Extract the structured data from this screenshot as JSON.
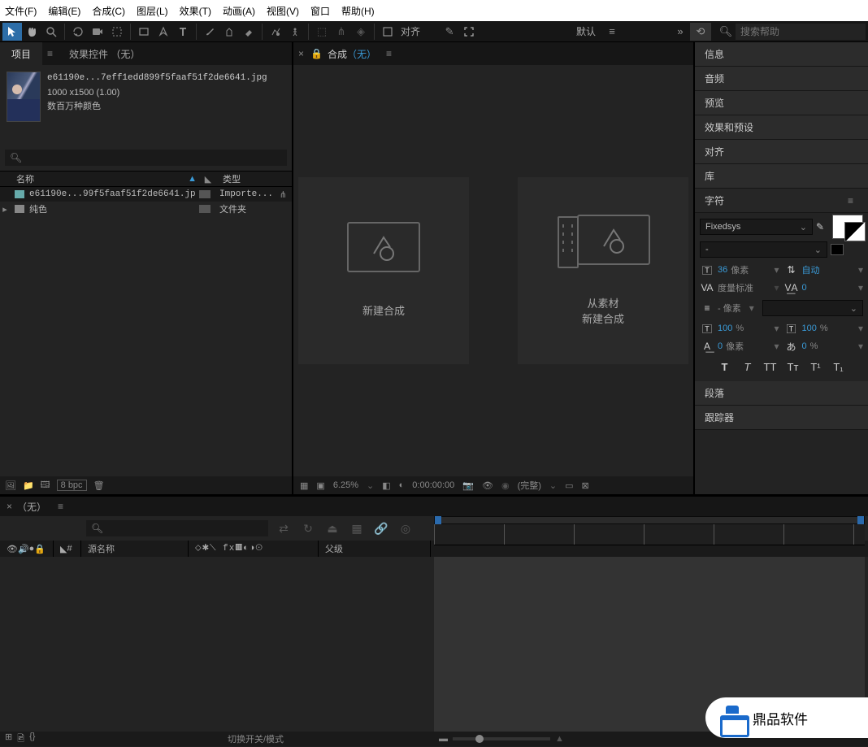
{
  "menu": {
    "file": "文件(F)",
    "edit": "编辑(E)",
    "comp": "合成(C)",
    "layer": "图层(L)",
    "effect": "效果(T)",
    "anim": "动画(A)",
    "view": "视图(V)",
    "window": "窗口",
    "help": "帮助(H)"
  },
  "toolbar": {
    "align": "对齐",
    "workspace": "默认",
    "search_ph": "搜索帮助"
  },
  "left": {
    "tab_project": "项目",
    "tab_effects": "效果控件 （无）",
    "file_name": "e61190e...7eff1edd899f5faaf51f2de6641.jpg",
    "file_dim": "1000 x1500 (1.00)",
    "file_colors": "数百万种颜色",
    "col_name": "名称",
    "col_type": "类型",
    "row1_name": "e61190e...99f5faaf51f2de6641.jp",
    "row1_type": "Importe...",
    "row2_name": "纯色",
    "row2_type": "文件夹",
    "bpc": "8 bpc"
  },
  "center": {
    "tab_label": "合成",
    "none": "（无）",
    "new_comp": "新建合成",
    "from_footage_l1": "从素材",
    "from_footage_l2": "新建合成",
    "zoom": "6.25%",
    "time": "0:00:00:00",
    "res": "(完整)"
  },
  "right": {
    "info": "信息",
    "audio": "音频",
    "preview": "预览",
    "presets": "效果和预设",
    "align": "对齐",
    "library": "库",
    "character": "字符",
    "paragraph": "段落",
    "tracker": "跟踪器",
    "font": "Fixedsys",
    "font_style": "-",
    "size_v": "36",
    "size_u": "像素",
    "leading": "自动",
    "tracking_lbl": "度量标准",
    "tracking_v": "0",
    "stroke_px": "- 像素",
    "hscale": "100",
    "hscale_u": "%",
    "vscale": "100",
    "vscale_u": "%",
    "baseline": "0",
    "baseline_u": "像素",
    "tsume": "0",
    "tsume_u": "%"
  },
  "timeline": {
    "tab": "（无）",
    "col_source": "源名称",
    "col_parent": "父级",
    "switches": "切换开关/模式"
  },
  "watermark": {
    "text": "鼎品软件"
  }
}
